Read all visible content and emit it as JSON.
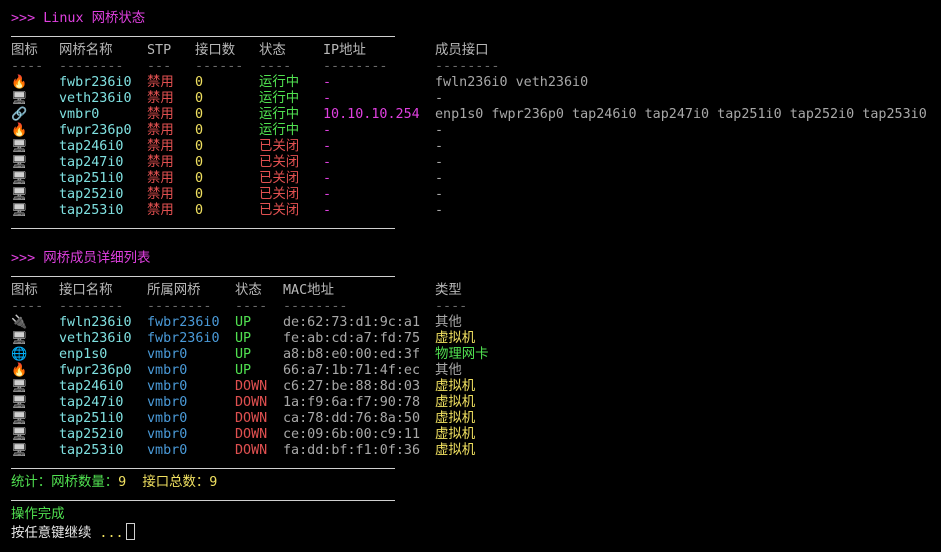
{
  "bridges_section": {
    "title": ">>> Linux 网桥状态",
    "headers": [
      "图标",
      "网桥名称",
      "STP",
      "接口数",
      "状态",
      "IP地址",
      "成员接口"
    ],
    "dashes": [
      "----",
      "--------",
      "---",
      "------",
      "----",
      "--------",
      "--------"
    ],
    "rows": [
      {
        "icon": "🔥",
        "icon_name": "fire-icon",
        "name": "fwbr236i0",
        "stp": "禁用",
        "count": "0",
        "status": "运行中",
        "ip": "-",
        "members": "fwln236i0 veth236i0"
      },
      {
        "icon": "🖥",
        "icon_name": "monitor-icon",
        "name": "veth236i0",
        "stp": "禁用",
        "count": "0",
        "status": "运行中",
        "ip": "-",
        "members": "-"
      },
      {
        "icon": "🔗",
        "icon_name": "link-icon",
        "name": "vmbr0",
        "stp": "禁用",
        "count": "0",
        "status": "运行中",
        "ip": "10.10.10.254",
        "members": "enp1s0 fwpr236p0 tap246i0 tap247i0 tap251i0 tap252i0 tap253i0"
      },
      {
        "icon": "🔥",
        "icon_name": "fire-icon",
        "name": "fwpr236p0",
        "stp": "禁用",
        "count": "0",
        "status": "运行中",
        "ip": "-",
        "members": "-"
      },
      {
        "icon": "🖥",
        "icon_name": "monitor-icon",
        "name": "tap246i0",
        "stp": "禁用",
        "count": "0",
        "status": "已关闭",
        "ip": "-",
        "members": "-"
      },
      {
        "icon": "🖥",
        "icon_name": "monitor-icon",
        "name": "tap247i0",
        "stp": "禁用",
        "count": "0",
        "status": "已关闭",
        "ip": "-",
        "members": "-"
      },
      {
        "icon": "🖥",
        "icon_name": "monitor-icon",
        "name": "tap251i0",
        "stp": "禁用",
        "count": "0",
        "status": "已关闭",
        "ip": "-",
        "members": "-"
      },
      {
        "icon": "🖥",
        "icon_name": "monitor-icon",
        "name": "tap252i0",
        "stp": "禁用",
        "count": "0",
        "status": "已关闭",
        "ip": "-",
        "members": "-"
      },
      {
        "icon": "🖥",
        "icon_name": "monitor-icon",
        "name": "tap253i0",
        "stp": "禁用",
        "count": "0",
        "status": "已关闭",
        "ip": "-",
        "members": "-"
      }
    ]
  },
  "members_section": {
    "title": ">>> 网桥成员详细列表",
    "headers": [
      "图标",
      "接口名称",
      "所属网桥",
      "状态",
      "MAC地址",
      "类型"
    ],
    "dashes": [
      "----",
      "--------",
      "--------",
      "----",
      "--------",
      "----"
    ],
    "rows": [
      {
        "icon": "🔌",
        "icon_name": "plug-icon",
        "name": "fwln236i0",
        "bridge": "fwbr236i0",
        "state": "UP",
        "mac": "de:62:73:d1:9c:a1",
        "type": "其他",
        "type_kind": "other"
      },
      {
        "icon": "🖥",
        "icon_name": "monitor-icon",
        "name": "veth236i0",
        "bridge": "fwbr236i0",
        "state": "UP",
        "mac": "fe:ab:cd:a7:fd:75",
        "type": "虚拟机",
        "type_kind": "vm"
      },
      {
        "icon": "🌐",
        "icon_name": "globe-icon",
        "name": "enp1s0",
        "bridge": "vmbr0",
        "state": "UP",
        "mac": "a8:b8:e0:00:ed:3f",
        "type": "物理网卡",
        "type_kind": "physical"
      },
      {
        "icon": "🔥",
        "icon_name": "fire-icon",
        "name": "fwpr236p0",
        "bridge": "vmbr0",
        "state": "UP",
        "mac": "66:a7:1b:71:4f:ec",
        "type": "其他",
        "type_kind": "other"
      },
      {
        "icon": "🖥",
        "icon_name": "monitor-icon",
        "name": "tap246i0",
        "bridge": "vmbr0",
        "state": "DOWN",
        "mac": "c6:27:be:88:8d:03",
        "type": "虚拟机",
        "type_kind": "vm"
      },
      {
        "icon": "🖥",
        "icon_name": "monitor-icon",
        "name": "tap247i0",
        "bridge": "vmbr0",
        "state": "DOWN",
        "mac": "1a:f9:6a:f7:90:78",
        "type": "虚拟机",
        "type_kind": "vm"
      },
      {
        "icon": "🖥",
        "icon_name": "monitor-icon",
        "name": "tap251i0",
        "bridge": "vmbr0",
        "state": "DOWN",
        "mac": "ca:78:dd:76:8a:50",
        "type": "虚拟机",
        "type_kind": "vm"
      },
      {
        "icon": "🖥",
        "icon_name": "monitor-icon",
        "name": "tap252i0",
        "bridge": "vmbr0",
        "state": "DOWN",
        "mac": "ce:09:6b:00:c9:11",
        "type": "虚拟机",
        "type_kind": "vm"
      },
      {
        "icon": "🖥",
        "icon_name": "monitor-icon",
        "name": "tap253i0",
        "bridge": "vmbr0",
        "state": "DOWN",
        "mac": "fa:dd:bf:f1:0f:36",
        "type": "虚拟机",
        "type_kind": "vm"
      }
    ]
  },
  "stats": {
    "prefix": "统计：",
    "bridge_count_label": "网桥数量：",
    "bridge_count": "9",
    "iface_total_label": "接口总数：",
    "iface_total": "9"
  },
  "footer": {
    "done": "操作完成",
    "prompt": "按任意键继续",
    "dots": "..."
  },
  "colors": {
    "background": "#000000",
    "title": "#e040e0",
    "name": "#7fe0e0",
    "bridge": "#4a9ad8",
    "disabled": "#e05050",
    "count": "#f0e060",
    "running": "#50e050",
    "stopped": "#e05050",
    "up": "#50e050",
    "down": "#e05050",
    "vm_type": "#f0e060",
    "physical_type": "#50e050",
    "other_type": "#a8a8a8",
    "ip": "#e040e0"
  }
}
